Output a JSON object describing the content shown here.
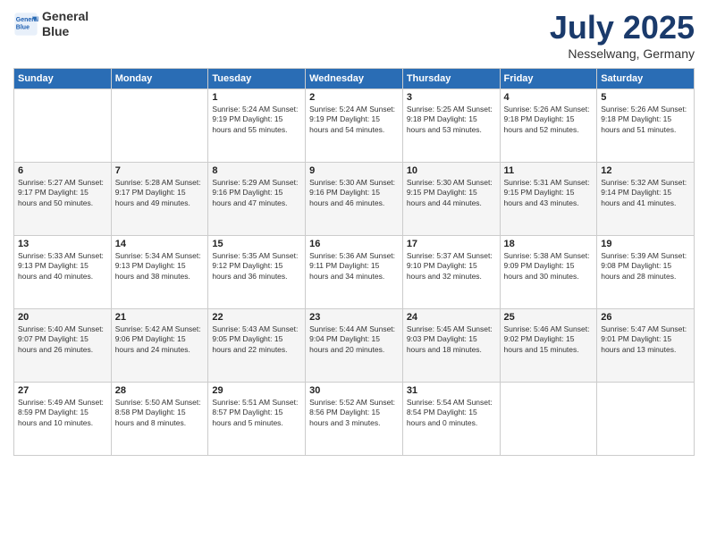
{
  "logo": {
    "line1": "General",
    "line2": "Blue"
  },
  "title": "July 2025",
  "subtitle": "Nesselwang, Germany",
  "weekdays": [
    "Sunday",
    "Monday",
    "Tuesday",
    "Wednesday",
    "Thursday",
    "Friday",
    "Saturday"
  ],
  "weeks": [
    [
      {
        "day": "",
        "info": ""
      },
      {
        "day": "",
        "info": ""
      },
      {
        "day": "1",
        "info": "Sunrise: 5:24 AM\nSunset: 9:19 PM\nDaylight: 15 hours\nand 55 minutes."
      },
      {
        "day": "2",
        "info": "Sunrise: 5:24 AM\nSunset: 9:19 PM\nDaylight: 15 hours\nand 54 minutes."
      },
      {
        "day": "3",
        "info": "Sunrise: 5:25 AM\nSunset: 9:18 PM\nDaylight: 15 hours\nand 53 minutes."
      },
      {
        "day": "4",
        "info": "Sunrise: 5:26 AM\nSunset: 9:18 PM\nDaylight: 15 hours\nand 52 minutes."
      },
      {
        "day": "5",
        "info": "Sunrise: 5:26 AM\nSunset: 9:18 PM\nDaylight: 15 hours\nand 51 minutes."
      }
    ],
    [
      {
        "day": "6",
        "info": "Sunrise: 5:27 AM\nSunset: 9:17 PM\nDaylight: 15 hours\nand 50 minutes."
      },
      {
        "day": "7",
        "info": "Sunrise: 5:28 AM\nSunset: 9:17 PM\nDaylight: 15 hours\nand 49 minutes."
      },
      {
        "day": "8",
        "info": "Sunrise: 5:29 AM\nSunset: 9:16 PM\nDaylight: 15 hours\nand 47 minutes."
      },
      {
        "day": "9",
        "info": "Sunrise: 5:30 AM\nSunset: 9:16 PM\nDaylight: 15 hours\nand 46 minutes."
      },
      {
        "day": "10",
        "info": "Sunrise: 5:30 AM\nSunset: 9:15 PM\nDaylight: 15 hours\nand 44 minutes."
      },
      {
        "day": "11",
        "info": "Sunrise: 5:31 AM\nSunset: 9:15 PM\nDaylight: 15 hours\nand 43 minutes."
      },
      {
        "day": "12",
        "info": "Sunrise: 5:32 AM\nSunset: 9:14 PM\nDaylight: 15 hours\nand 41 minutes."
      }
    ],
    [
      {
        "day": "13",
        "info": "Sunrise: 5:33 AM\nSunset: 9:13 PM\nDaylight: 15 hours\nand 40 minutes."
      },
      {
        "day": "14",
        "info": "Sunrise: 5:34 AM\nSunset: 9:13 PM\nDaylight: 15 hours\nand 38 minutes."
      },
      {
        "day": "15",
        "info": "Sunrise: 5:35 AM\nSunset: 9:12 PM\nDaylight: 15 hours\nand 36 minutes."
      },
      {
        "day": "16",
        "info": "Sunrise: 5:36 AM\nSunset: 9:11 PM\nDaylight: 15 hours\nand 34 minutes."
      },
      {
        "day": "17",
        "info": "Sunrise: 5:37 AM\nSunset: 9:10 PM\nDaylight: 15 hours\nand 32 minutes."
      },
      {
        "day": "18",
        "info": "Sunrise: 5:38 AM\nSunset: 9:09 PM\nDaylight: 15 hours\nand 30 minutes."
      },
      {
        "day": "19",
        "info": "Sunrise: 5:39 AM\nSunset: 9:08 PM\nDaylight: 15 hours\nand 28 minutes."
      }
    ],
    [
      {
        "day": "20",
        "info": "Sunrise: 5:40 AM\nSunset: 9:07 PM\nDaylight: 15 hours\nand 26 minutes."
      },
      {
        "day": "21",
        "info": "Sunrise: 5:42 AM\nSunset: 9:06 PM\nDaylight: 15 hours\nand 24 minutes."
      },
      {
        "day": "22",
        "info": "Sunrise: 5:43 AM\nSunset: 9:05 PM\nDaylight: 15 hours\nand 22 minutes."
      },
      {
        "day": "23",
        "info": "Sunrise: 5:44 AM\nSunset: 9:04 PM\nDaylight: 15 hours\nand 20 minutes."
      },
      {
        "day": "24",
        "info": "Sunrise: 5:45 AM\nSunset: 9:03 PM\nDaylight: 15 hours\nand 18 minutes."
      },
      {
        "day": "25",
        "info": "Sunrise: 5:46 AM\nSunset: 9:02 PM\nDaylight: 15 hours\nand 15 minutes."
      },
      {
        "day": "26",
        "info": "Sunrise: 5:47 AM\nSunset: 9:01 PM\nDaylight: 15 hours\nand 13 minutes."
      }
    ],
    [
      {
        "day": "27",
        "info": "Sunrise: 5:49 AM\nSunset: 8:59 PM\nDaylight: 15 hours\nand 10 minutes."
      },
      {
        "day": "28",
        "info": "Sunrise: 5:50 AM\nSunset: 8:58 PM\nDaylight: 15 hours\nand 8 minutes."
      },
      {
        "day": "29",
        "info": "Sunrise: 5:51 AM\nSunset: 8:57 PM\nDaylight: 15 hours\nand 5 minutes."
      },
      {
        "day": "30",
        "info": "Sunrise: 5:52 AM\nSunset: 8:56 PM\nDaylight: 15 hours\nand 3 minutes."
      },
      {
        "day": "31",
        "info": "Sunrise: 5:54 AM\nSunset: 8:54 PM\nDaylight: 15 hours\nand 0 minutes."
      },
      {
        "day": "",
        "info": ""
      },
      {
        "day": "",
        "info": ""
      }
    ]
  ]
}
